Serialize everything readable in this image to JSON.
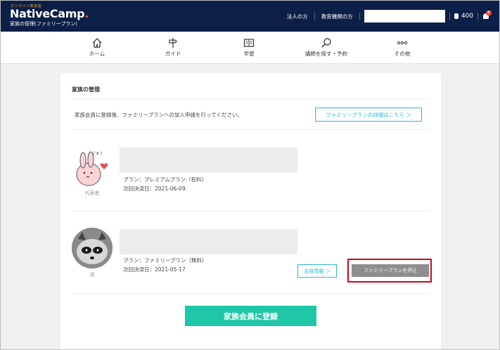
{
  "header": {
    "logo_tagline": "オンライン英会話",
    "logo_name": "NativeCamp",
    "logo_dot": ".",
    "page_subtitle": "家族の管理(ファミリープラン)",
    "links": [
      "法人の方",
      "教育機関の方"
    ],
    "coins": "400",
    "notification_count": "8"
  },
  "nav": {
    "items": [
      {
        "label": "ホーム",
        "icon": "home-icon"
      },
      {
        "label": "ガイド",
        "icon": "signpost-icon"
      },
      {
        "label": "学習",
        "icon": "book-icon"
      },
      {
        "label": "講師を探す・予約",
        "icon": "search-icon"
      },
      {
        "label": "その他",
        "icon": "more-icon"
      }
    ]
  },
  "card": {
    "title": "家族の管理",
    "intro": "家族会員に登録後、ファミリープランへの加入申請を行ってください。",
    "detail_button": "ファミリープランの詳細はこちら ＞",
    "members": [
      {
        "role": "代表者",
        "plan": "プラン：プレミアムプラン（有料）",
        "next_payment": "次回決済日：2021-06-09"
      },
      {
        "role": "孫",
        "plan": "プラン：ファミリープラン（無料）",
        "next_payment": "次回決済日：2021-05-17",
        "info_button": "会員情報 ＞",
        "stop_button": "ファミリープランを停止"
      }
    ],
    "register_button": "家族会員に登録"
  },
  "colors": {
    "header_bg": "#0c1f47",
    "accent": "#2ab8d6",
    "register": "#1fc7a8",
    "highlight": "#d0021b"
  }
}
